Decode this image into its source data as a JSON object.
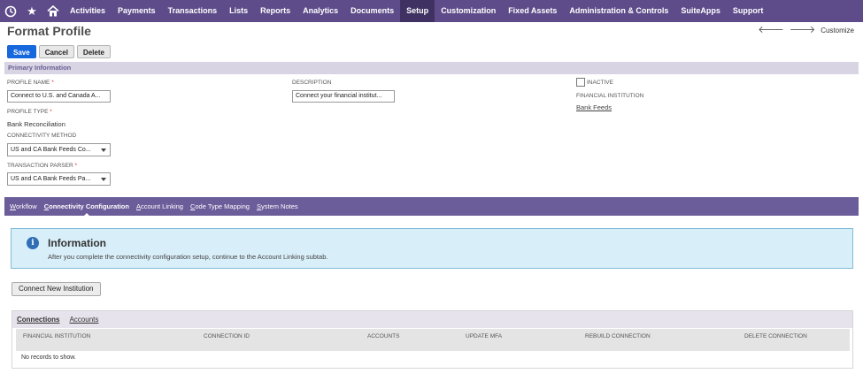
{
  "nav": {
    "items": [
      "Activities",
      "Payments",
      "Transactions",
      "Lists",
      "Reports",
      "Analytics",
      "Documents",
      "Setup",
      "Customization",
      "Fixed Assets",
      "Administration & Controls",
      "SuiteApps",
      "Support"
    ],
    "active": "Setup",
    "icons": [
      "recent-icon",
      "star-icon",
      "home-icon"
    ]
  },
  "page": {
    "title": "Format Profile",
    "customize_label": "Customize"
  },
  "buttons": {
    "save": "Save",
    "cancel": "Cancel",
    "delete": "Delete"
  },
  "primary": {
    "section_title": "Primary Information",
    "profile_name_label": "PROFILE NAME",
    "profile_name_value": "Connect to U.S. and Canada A...",
    "profile_type_label": "PROFILE TYPE",
    "profile_type_value": "Bank Reconciliation",
    "connectivity_label": "CONNECTIVITY METHOD",
    "connectivity_value": "US and CA Bank Feeds Co...",
    "parser_label": "TRANSACTION PARSER",
    "parser_value": "US and CA Bank Feeds Pa...",
    "description_label": "DESCRIPTION",
    "description_value": "Connect your financial institut...",
    "inactive_label": "INACTIVE",
    "institution_label": "FINANCIAL INSTITUTION",
    "institution_value": "Bank Feeds"
  },
  "subtabs": [
    {
      "first": "W",
      "rest": "orkflow"
    },
    {
      "first": "C",
      "rest": "onnectivity Configuration"
    },
    {
      "first": "A",
      "rest": "ccount Linking"
    },
    {
      "first": "C",
      "rest": "ode Type Mapping"
    },
    {
      "first": "S",
      "rest": "ystem Notes"
    }
  ],
  "info": {
    "title": "Information",
    "text": "After you complete the connectivity configuration setup, continue to the Account Linking subtab."
  },
  "connect_button": "Connect New Institution",
  "connections": {
    "tabs": [
      "Connections",
      "Accounts"
    ],
    "columns": [
      "FINANCIAL INSTITUTION",
      "CONNECTION ID",
      "ACCOUNTS",
      "UPDATE MFA",
      "REBUILD CONNECTION",
      "DELETE CONNECTION"
    ],
    "empty_text": "No records to show."
  },
  "colors": {
    "nav_bg": "#5e4c8a",
    "nav_active": "#3f3262",
    "subtab_bg": "#6b5c9a",
    "primary_button": "#1767dd",
    "info_bg": "#d8eef8"
  }
}
